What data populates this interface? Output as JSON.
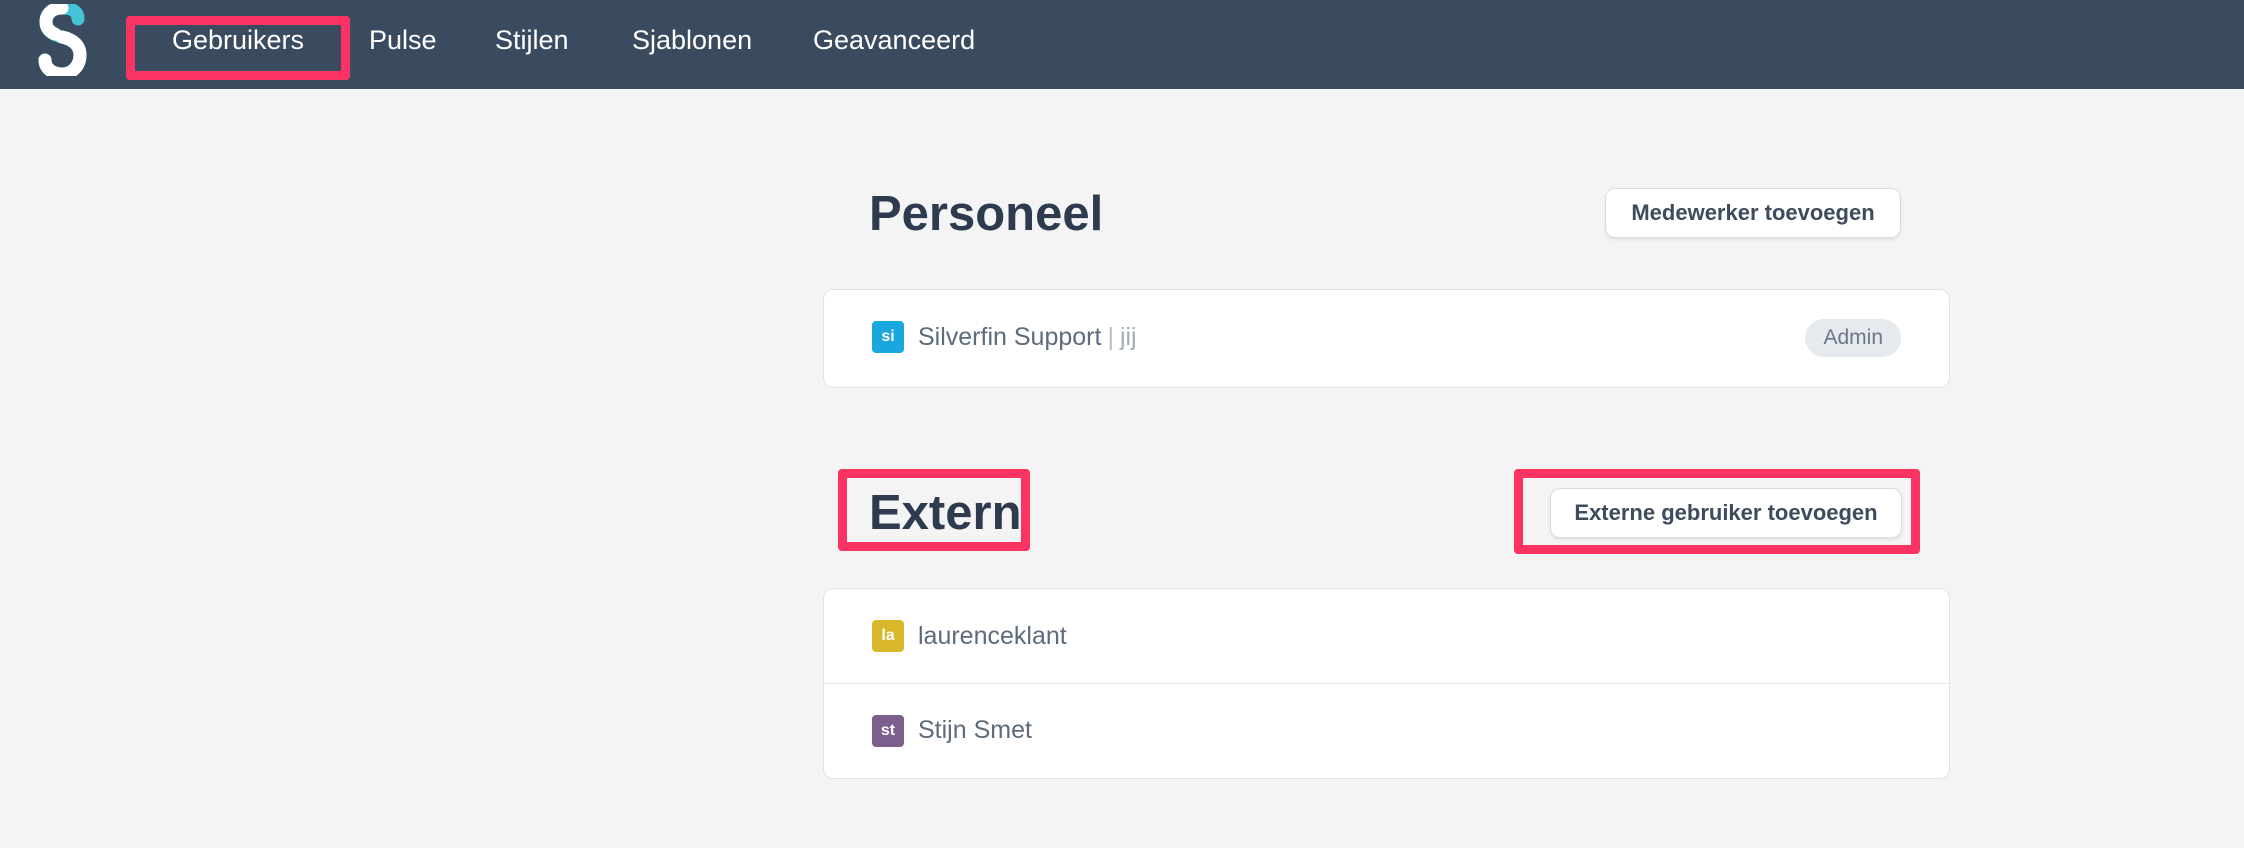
{
  "nav": {
    "items": [
      {
        "label": "Gebruikers"
      },
      {
        "label": "Pulse"
      },
      {
        "label": "Stijlen"
      },
      {
        "label": "Sjablonen"
      },
      {
        "label": "Geavanceerd"
      }
    ],
    "active": "Gebruikers"
  },
  "staff": {
    "title": "Personeel",
    "add_button": "Medewerker toevoegen",
    "users": [
      {
        "initials": "si",
        "name": "Silverfin Support",
        "separator": "|",
        "you_label": "jij",
        "role": "Admin",
        "avatar_color": "#1aa7e0"
      }
    ]
  },
  "external": {
    "title": "Extern",
    "add_button": "Externe gebruiker toevoegen",
    "users": [
      {
        "initials": "la",
        "name": "laurenceklant",
        "avatar_color": "#d9b92b"
      },
      {
        "initials": "st",
        "name": "Stijn Smet",
        "avatar_color": "#7a5f8f"
      }
    ]
  },
  "colors": {
    "topbar": "#3a4a5f",
    "highlight": "#fa3363",
    "background": "#f4f4f4",
    "logo_primary": "#ffffff",
    "logo_accent": "#46c3d6"
  }
}
